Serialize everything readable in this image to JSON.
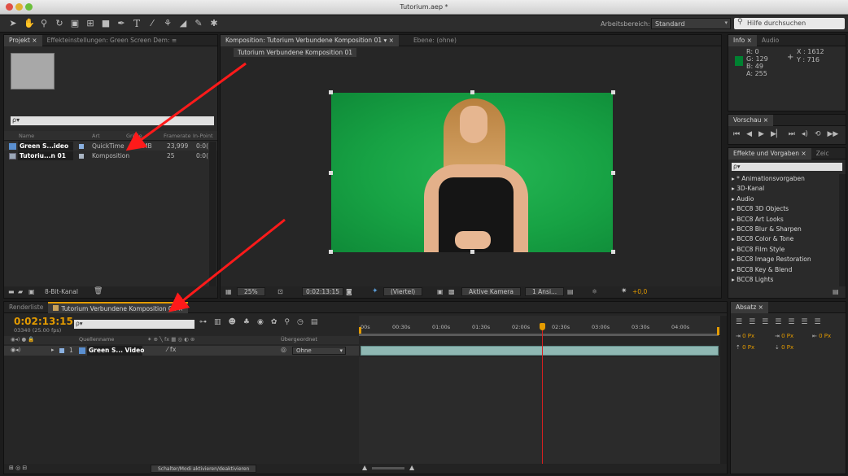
{
  "window": {
    "title": "Tutorium.aep *"
  },
  "toolbar": {
    "tools": [
      "selection-tool-icon",
      "hand-tool-icon",
      "zoom-tool-icon",
      "rotate-tool-icon",
      "camera-tool-icon",
      "pan-behind-tool-icon",
      "mask-tool-icon",
      "pen-tool-icon",
      "text-tool-icon",
      "brush-tool-icon",
      "clone-tool-icon",
      "eraser-tool-icon",
      "roto-brush-tool-icon",
      "puppet-tool-icon"
    ],
    "workspace_label": "Arbeitsbereich:",
    "workspace_value": "Standard",
    "help_placeholder": "Hilfe durchsuchen"
  },
  "project_panel": {
    "tabs": [
      "Projekt ×",
      "Effekteinstellungen: Green Screen Dem: ≡"
    ],
    "search_placeholder": "ρ▾",
    "columns": [
      "Name",
      "Art",
      "Größe",
      "Framerate",
      "In-Point"
    ],
    "items": [
      {
        "name": "Green S...ideo",
        "type": "QuickTime",
        "size": "MB",
        "framerate": "23,999",
        "inpoint": "0:0("
      },
      {
        "name": "Tutoriu...n 01",
        "type": "Komposition",
        "size": "",
        "framerate": "25",
        "inpoint": "0:0("
      }
    ],
    "footer_bpc": "8-Bit-Kanal"
  },
  "composition_panel": {
    "tab_title": "Komposition: Tutorium Verbundene Komposition 01",
    "layer_tab": "Ebene: (ohne)",
    "breadcrumb": "Tutorium Verbundene Komposition 01",
    "footer": {
      "zoom": "25%",
      "timecode": "0:02:13:15",
      "resolution": "(Viertel)",
      "camera": "Aktive Kamera",
      "views": "1 Ansi...",
      "exposure": "+0,0"
    }
  },
  "info_panel": {
    "tabs": [
      "Info ×",
      "Audio"
    ],
    "r": "R: 0",
    "g": "G: 129",
    "b": "B: 49",
    "a": "A: 255",
    "x": "X : 1612",
    "y": "Y : 716",
    "swatch_color": "#008131"
  },
  "preview_panel": {
    "tab": "Vorschau ×"
  },
  "effects_panel": {
    "tabs": [
      "Effekte und Vorgaben ×",
      "Zeic"
    ],
    "search_placeholder": "ρ▾",
    "items": [
      "▸ * Animationsvorgaben",
      "▸ 3D-Kanal",
      "▸ Audio",
      "▸ BCC8 3D Objects",
      "▸ BCC8 Art Looks",
      "▸ BCC8 Blur & Sharpen",
      "▸ BCC8 Color & Tone",
      "▸ BCC8 Film Style",
      "▸ BCC8 Image Restoration",
      "▸ BCC8 Key & Blend",
      "▸ BCC8 Lights"
    ]
  },
  "paragraph_panel": {
    "tab": "Absatz ×",
    "indent_values": [
      "0 Px",
      "0 Px",
      "0 Px",
      "0 Px",
      "0 Px"
    ]
  },
  "timeline": {
    "tabs": [
      "Renderliste",
      "Tutorium Verbundene Komposition 01 ×"
    ],
    "timecode": "0:02:13:15",
    "frames": "03340 (25.00 fps)",
    "search_placeholder": "ρ▾",
    "columns": {
      "source_name": "Quellenname",
      "parent": "Übergeordnet"
    },
    "layers": [
      {
        "index": "1",
        "name": "Green S... Video",
        "parent": "Ohne"
      }
    ],
    "ruler": [
      "00s",
      "00:30s",
      "01:00s",
      "01:30s",
      "02:00s",
      "02:30s",
      "03:00s",
      "03:30s",
      "04:00s"
    ],
    "playhead_fraction": 0.506,
    "footer_toggle": "Schalter/Modi aktivieren/deaktivieren"
  },
  "colors": {
    "accent": "#e49b00",
    "playhead": "#d62020",
    "green_screen": "#1fa14a"
  }
}
